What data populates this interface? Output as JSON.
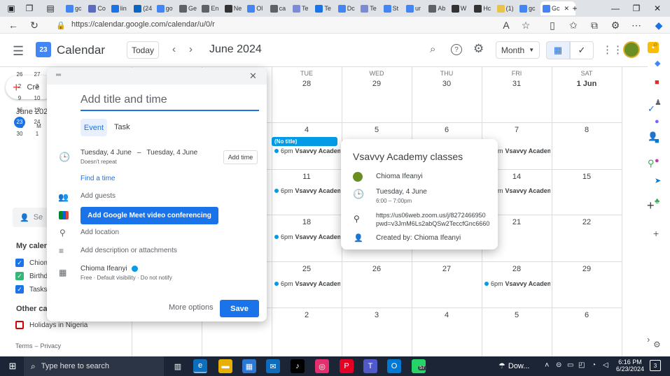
{
  "browser": {
    "tabs": [
      {
        "label": "gc",
        "color": "#4285f4"
      },
      {
        "label": "Co",
        "color": "#5c6bc0"
      },
      {
        "label": "lin",
        "color": "#1a73e8"
      },
      {
        "label": "(24",
        "color": "#0a66c2"
      },
      {
        "label": "go",
        "color": "#4285f4"
      },
      {
        "label": "Ge",
        "color": "#5f6368"
      },
      {
        "label": "En",
        "color": "#5f6368"
      },
      {
        "label": "Ne",
        "color": "#333333"
      },
      {
        "label": "Ol",
        "color": "#4285f4"
      },
      {
        "label": "ca",
        "color": "#5f6368"
      },
      {
        "label": "Te",
        "color": "#7b8bd6"
      },
      {
        "label": "Te",
        "color": "#1a73e8"
      },
      {
        "label": "Dc",
        "color": "#4285f4"
      },
      {
        "label": "Te",
        "color": "#7b8bd6"
      },
      {
        "label": "St",
        "color": "#4285f4"
      },
      {
        "label": "ur",
        "color": "#4285f4"
      },
      {
        "label": "Ab",
        "color": "#5f6368"
      },
      {
        "label": "W",
        "color": "#333333"
      },
      {
        "label": "Hc",
        "color": "#333333"
      },
      {
        "label": "(1)",
        "color": "#e8c547"
      },
      {
        "label": "gc",
        "color": "#4285f4"
      }
    ],
    "active_tab": {
      "label": "Gc",
      "close": "✕"
    },
    "new_tab": "+",
    "url": "https://calendar.google.com/calendar/u/0/r"
  },
  "header": {
    "app_title": "Calendar",
    "logo_text": "23",
    "today_button": "Today",
    "month_title": "June 2024",
    "view_select": "Month"
  },
  "sidebar": {
    "create_label": "Cre",
    "mini_month": "June 2024",
    "mini_dow": [
      "S",
      "M"
    ],
    "mini_rows": [
      [
        "26",
        "27"
      ],
      [
        "2",
        "3"
      ],
      [
        "9",
        "10"
      ],
      [
        "16",
        "17"
      ],
      [
        "23",
        "24"
      ],
      [
        "30",
        "1"
      ]
    ],
    "search_placeholder": "Se",
    "my_calendars": "My calen",
    "calendars": [
      {
        "label": "Chiom",
        "color": "#1a73e8"
      },
      {
        "label": "Birthd",
        "color": "#33b679"
      },
      {
        "label": "Tasks",
        "color": "#1a73e8"
      }
    ],
    "other_calendars": "Other cal",
    "holidays": "Holidays in Nigeria",
    "terms": "Terms",
    "privacy": "Privacy",
    "terms_sep": "–"
  },
  "grid": {
    "weekdays": [
      {
        "dow": "",
        "date": ""
      },
      {
        "dow": "",
        "date": ""
      },
      {
        "dow": "TUE",
        "date": "28"
      },
      {
        "dow": "WED",
        "date": "29"
      },
      {
        "dow": "THU",
        "date": "30"
      },
      {
        "dow": "FRI",
        "date": "31"
      },
      {
        "dow": "SAT",
        "date": "1 Jun"
      }
    ],
    "rows": [
      [
        "",
        "",
        "4",
        "5",
        "6",
        "7",
        "8"
      ],
      [
        "",
        "",
        "11",
        "12",
        "13",
        "14",
        "15"
      ],
      [
        "",
        "",
        "18",
        "19",
        "20",
        "21",
        "22"
      ],
      [
        "",
        "",
        "25",
        "26",
        "27",
        "28",
        "29"
      ],
      [
        "",
        "",
        "2",
        "3",
        "4",
        "5",
        "6"
      ]
    ],
    "no_title_chip": "(No title)",
    "event_time": "6pm",
    "event_name": "Vsavvy Academ"
  },
  "dialog": {
    "title_placeholder": "Add title and time",
    "tab_event": "Event",
    "tab_task": "Task",
    "date_start": "Tuesday, 4 June",
    "date_dash": "–",
    "date_end": "Tuesday, 4 June",
    "repeat": "Doesn't repeat",
    "add_time": "Add time",
    "find_time": "Find a time",
    "add_guests": "Add guests",
    "meet_button": "Add Google Meet video conferencing",
    "add_location": "Add location",
    "add_description": "Add description or attachments",
    "owner": "Chioma Ifeanyi",
    "owner_meta": "Free · Default visibility · Do not notify",
    "more_options": "More options",
    "save": "Save"
  },
  "popover": {
    "title": "Vsavvy Academy classes",
    "organizer": "Chioma Ifeanyi",
    "date": "Tuesday, 4 June",
    "time": "6:00 – 7:00pm",
    "link_line1": "https://us06web.zoom.us/j/8272466950",
    "link_line2": "pwd=v3JmM6Ls2abQSw2TeccfGnc6660",
    "created_by": "Created by: Chioma Ifeanyi"
  },
  "taskbar": {
    "search_placeholder": "Type here to search",
    "whatsapp_badge": "57",
    "weather": "Dow...",
    "time": "6:16 PM",
    "date": "6/23/2024",
    "notif_count": "3"
  },
  "colors": {
    "accent": "#1a73e8",
    "event_dot": "#039be5",
    "chip": "#039be5"
  }
}
